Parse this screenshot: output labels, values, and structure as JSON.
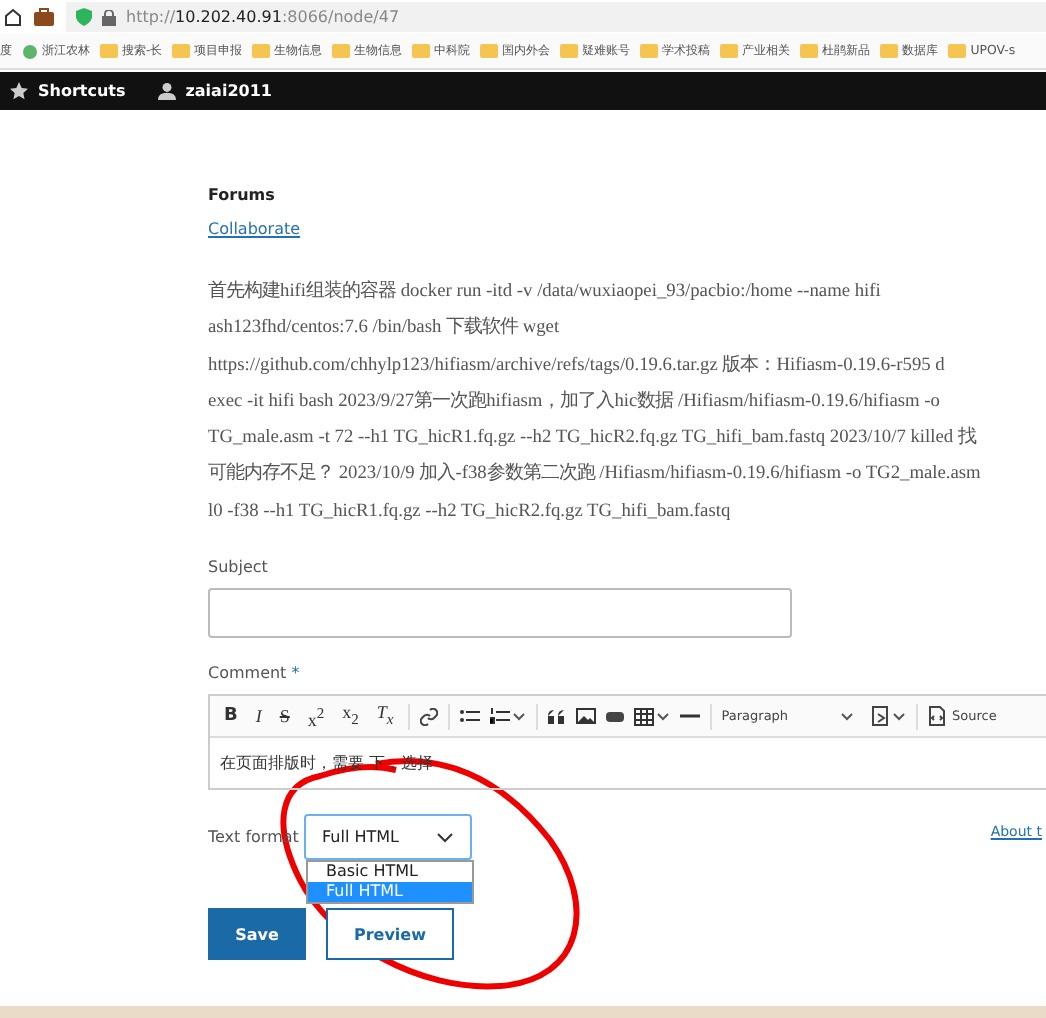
{
  "browser": {
    "url_scheme": "http://",
    "url_host": "10.202.40.91",
    "url_rest": ":8066/node/47",
    "bookmarks_lead": "度",
    "bookmarks": [
      "浙江农林",
      "搜索-长",
      "项目申报",
      "生物信息",
      "生物信息",
      "中科院",
      "国内外会",
      "疑难账号",
      "学术投稿",
      "产业相关",
      "杜鹃新品",
      "数据库",
      "UPOV-s"
    ]
  },
  "admin_bar": [
    {
      "kind": "star",
      "label": "Shortcuts"
    },
    {
      "kind": "user",
      "label": "zaiai2011"
    }
  ],
  "forum": {
    "label": "Forums",
    "link": "Collaborate"
  },
  "body_lines": [
    "首先构建hifi组装的容器 docker run -itd -v /data/wuxiaopei_93/pacbio:/home --name hifi",
    "ash123fhd/centos:7.6 /bin/bash 下载软件 wget",
    "https://github.com/chhylp123/hifiasm/archive/refs/tags/0.19.6.tar.gz 版本：Hifiasm-0.19.6-r595 d",
    "exec -it hifi bash 2023/9/27第一次跑hifiasm，加了入hic数据 /Hifiasm/hifiasm-0.19.6/hifiasm -o",
    "TG_male.asm -t 72 --h1 TG_hicR1.fq.gz --h2 TG_hicR2.fq.gz TG_hifi_bam.fastq 2023/10/7 killed 找",
    "可能内存不足？ 2023/10/9 加入-f38参数第二次跑 /Hifiasm/hifiasm-0.19.6/hifiasm -o TG2_male.asm",
    "l0 -f38 --h1 TG_hicR1.fq.gz --h2 TG_hicR2.fq.gz TG_hifi_bam.fastq"
  ],
  "subject": {
    "label": "Subject"
  },
  "comment": {
    "label": "Comment",
    "required": "*",
    "text": "在页面排版时，需要     下，选择"
  },
  "editor_tools": [
    {
      "kind": "bold",
      "glyph": "B"
    },
    {
      "kind": "italic",
      "glyph": "I"
    },
    {
      "kind": "strike",
      "glyph": "S"
    },
    {
      "kind": "superscript",
      "glyph": "x$^{2}$"
    },
    {
      "kind": "subscript",
      "glyph": "x$_{2}$"
    },
    {
      "kind": "clear",
      "glyph": "T$_{x}$"
    },
    {
      "kind": "sep"
    },
    {
      "kind": "link"
    },
    {
      "kind": "sep"
    },
    {
      "kind": "bullets"
    },
    {
      "kind": "numbers"
    },
    {
      "kind": "sep"
    },
    {
      "kind": "quote"
    },
    {
      "kind": "image"
    },
    {
      "kind": "media"
    },
    {
      "kind": "table"
    },
    {
      "kind": "rule"
    },
    {
      "kind": "sep"
    },
    {
      "kind": "select",
      "label": "Paragraph"
    },
    {
      "kind": "insert"
    },
    {
      "kind": "sep"
    },
    {
      "kind": "source",
      "label": "Source"
    }
  ],
  "text_format": {
    "label": "Text format",
    "value": "Full HTML",
    "options": [
      {
        "label": "Basic HTML",
        "selected": false
      },
      {
        "label": "Full HTML",
        "selected": true
      }
    ],
    "about": "About t"
  },
  "buttons": [
    {
      "label": "Save",
      "kind": "primary"
    },
    {
      "label": "Preview",
      "kind": "secondary"
    }
  ]
}
